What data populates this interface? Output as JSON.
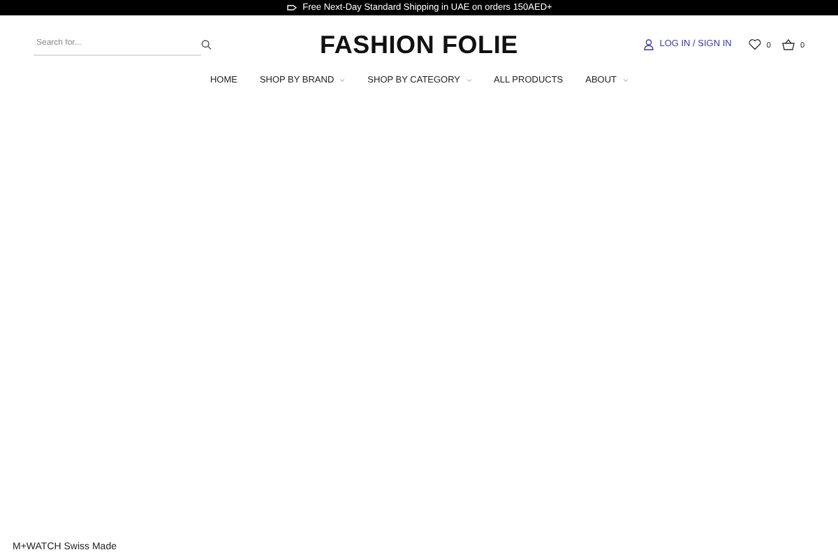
{
  "announcement": "Free Next-Day Standard Shipping in UAE on orders 150AED+",
  "search": {
    "placeholder": "Search for..."
  },
  "logo": "FASHION FOLIE",
  "account": {
    "label": "LOG IN / SIGN IN"
  },
  "wishlist": {
    "count": "0"
  },
  "cart": {
    "count": "0"
  },
  "nav": [
    {
      "label": "HOME",
      "kind": "link"
    },
    {
      "label": "SHOP BY BRAND",
      "kind": "dropdown"
    },
    {
      "label": "SHOP BY CATEGORY",
      "kind": "dropdown"
    },
    {
      "label": "ALL PRODUCTS",
      "kind": "link"
    },
    {
      "label": "ABOUT",
      "kind": "dropdown"
    }
  ],
  "footer_caption": "M+WATCH Swiss Made"
}
